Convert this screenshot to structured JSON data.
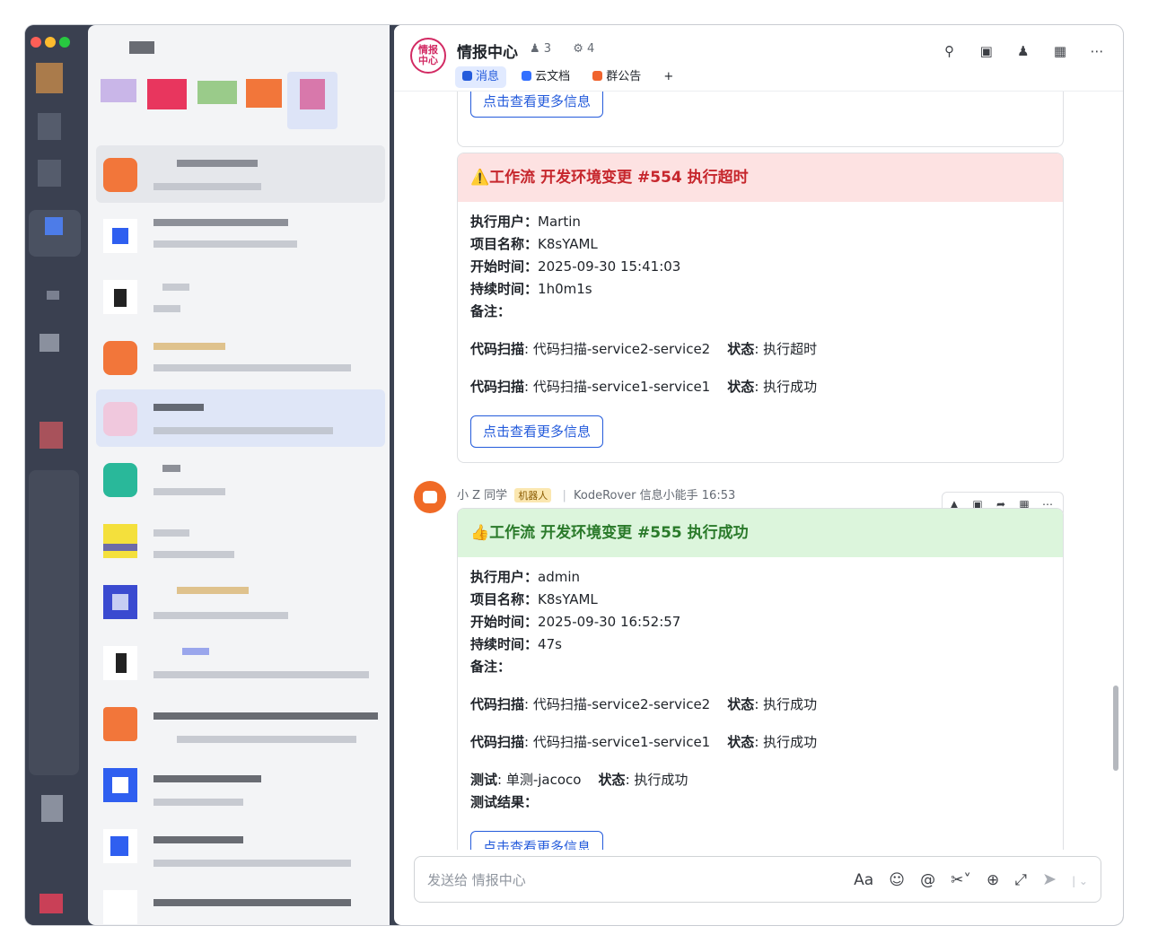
{
  "chat": {
    "logo_line1": "情报",
    "logo_line2": "中心",
    "title": "情报中心",
    "members": "3",
    "bots": "4",
    "tabs": [
      {
        "label": "消息"
      },
      {
        "label": "云文档"
      },
      {
        "label": "群公告"
      },
      {
        "label": "+"
      }
    ]
  },
  "header_icons": [
    "search-icon",
    "video-call-icon",
    "add-member-icon",
    "calendar-icon",
    "more-icon"
  ],
  "partial_button": "点击查看更多信息",
  "messages": [
    {
      "title": "⚠️工作流 开发环境变更 #554 执行超时",
      "status_color": "#c6262c",
      "fields": [
        {
          "k": "执行用户",
          "v": "Martin"
        },
        {
          "k": "项目名称",
          "v": "K8sYAML"
        },
        {
          "k": "开始时间",
          "v": "2025-09-30 15:41:03"
        },
        {
          "k": "持续时间",
          "v": "1h0m1s"
        },
        {
          "k": "备注",
          "v": ""
        }
      ],
      "scans": [
        {
          "k": "代码扫描",
          "v": "代码扫描-service2-service2",
          "sk": "状态",
          "sv": "执行超时"
        },
        {
          "k": "代码扫描",
          "v": "代码扫描-service1-service1",
          "sk": "状态",
          "sv": "执行成功"
        }
      ],
      "button": "点击查看更多信息"
    },
    {
      "sender": "小 Z 同学",
      "sender_tag": "机器人",
      "source": "KodeRover 信息小能手",
      "time": "16:53",
      "title": "👍工作流 开发环境变更 #555 执行成功",
      "status_color": "#2a7a2a",
      "fields": [
        {
          "k": "执行用户",
          "v": "admin"
        },
        {
          "k": "项目名称",
          "v": "K8sYAML"
        },
        {
          "k": "开始时间",
          "v": "2025-09-30 16:52:57"
        },
        {
          "k": "持续时间",
          "v": "47s"
        },
        {
          "k": "备注",
          "v": ""
        }
      ],
      "scans": [
        {
          "k": "代码扫描",
          "v": "代码扫描-service2-service2",
          "sk": "状态",
          "sv": "执行成功"
        },
        {
          "k": "代码扫描",
          "v": "代码扫描-service1-service1",
          "sk": "状态",
          "sv": "执行成功"
        }
      ],
      "test": {
        "k": "测试",
        "v": "单测-jacoco",
        "sk": "状态",
        "sv": "执行成功"
      },
      "test_result": {
        "k": "测试结果",
        "v": ""
      },
      "button": "点击查看更多信息"
    }
  ],
  "composer": {
    "placeholder": "发送给 情报中心"
  },
  "composer_icons": [
    "text-format-icon",
    "emoji-icon",
    "mention-icon",
    "screenshot-icon",
    "add-icon",
    "expand-icon",
    "send-icon"
  ]
}
